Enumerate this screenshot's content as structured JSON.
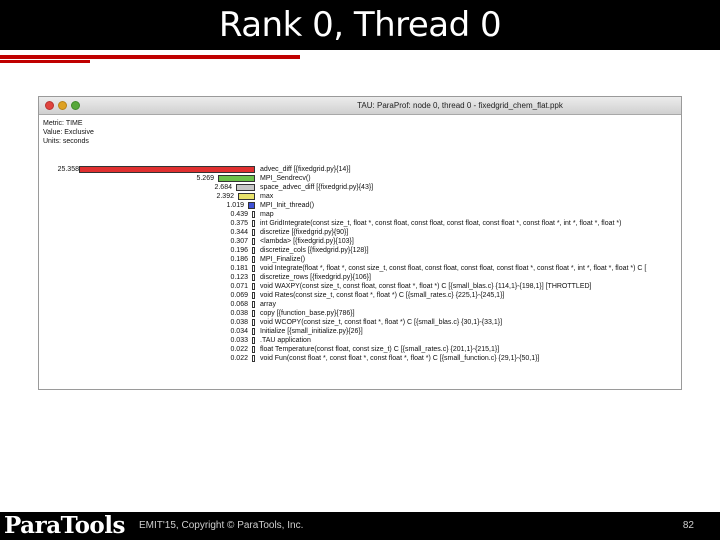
{
  "slide": {
    "title": "Rank 0, Thread 0",
    "footer": "EMIT'15, Copyright © ParaTools, Inc.",
    "page_number": "82",
    "logo_text": "ParaTools",
    "accent_color": "#c00000"
  },
  "window": {
    "title": "TAU: ParaProf: node 0, thread 0 - fixedgrid_chem_flat.ppk"
  },
  "metric": {
    "metric_line": "Metric: TIME",
    "value_line": "Value: Exclusive",
    "units_line": "Units: seconds"
  },
  "chart_data": {
    "type": "bar",
    "orientation": "horizontal",
    "metric": "TIME",
    "value": "Exclusive",
    "units": "seconds",
    "series": [
      {
        "value": "25.358",
        "v": 25.358,
        "label": "advec_diff [{fixedgrid.py}{14}]",
        "color": "#e03030"
      },
      {
        "value": "5.269",
        "v": 5.269,
        "label": "MPI_Sendrecv()",
        "color": "#6cc24a"
      },
      {
        "value": "2.684",
        "v": 2.684,
        "label": "space_advec_diff [{fixedgrid.py}{43}]",
        "color": "#c8c8c8"
      },
      {
        "value": "2.392",
        "v": 2.392,
        "label": "max",
        "color": "#e8e26a"
      },
      {
        "value": "1.019",
        "v": 1.019,
        "label": "MPI_Init_thread()",
        "color": "#3f52d6"
      },
      {
        "value": "0.439",
        "v": 0.439,
        "label": "map",
        "color": "#ffffff"
      },
      {
        "value": "0.375",
        "v": 0.375,
        "label": "int GridIntegrate(const size_t, float *, const float, const float, const float, const float *, const float *, int *, float *, float *)",
        "color": "#ffffff"
      },
      {
        "value": "0.344",
        "v": 0.344,
        "label": "discretize [{fixedgrid.py}{90}]",
        "color": "#ffffff"
      },
      {
        "value": "0.307",
        "v": 0.307,
        "label": "<lambda> [{fixedgrid.py}{103}]",
        "color": "#ffffff"
      },
      {
        "value": "0.196",
        "v": 0.196,
        "label": "discretize_cols [{fixedgrid.py}{128}]",
        "color": "#ffffff"
      },
      {
        "value": "0.186",
        "v": 0.186,
        "label": "MPI_Finalize()",
        "color": "#ffffff"
      },
      {
        "value": "0.181",
        "v": 0.181,
        "label": "void Integrate(float *, float *, const size_t, const float, const float, const float, const float *, const float *, int *, float *, float *) C [",
        "color": "#ffffff"
      },
      {
        "value": "0.123",
        "v": 0.123,
        "label": "discretize_rows [{fixedgrid.py}{106}]",
        "color": "#ffffff"
      },
      {
        "value": "0.071",
        "v": 0.071,
        "label": "void WAXPY(const size_t, const float, const float *, float *) C [{small_blas.c} {114,1}-{198,1}] [THROTTLED]",
        "color": "#ffffff"
      },
      {
        "value": "0.069",
        "v": 0.069,
        "label": "void Rates(const size_t, const float *, float *) C [{small_rates.c} {225,1}-{245,1}]",
        "color": "#ffffff"
      },
      {
        "value": "0.068",
        "v": 0.068,
        "label": "array",
        "color": "#ffffff"
      },
      {
        "value": "0.038",
        "v": 0.038,
        "label": "copy [{function_base.py}{786}]",
        "color": "#ffffff"
      },
      {
        "value": "0.038",
        "v": 0.038,
        "label": "void WCOPY(const size_t, const float *, float *) C [{small_blas.c} {30,1}-{33,1}]",
        "color": "#ffffff"
      },
      {
        "value": "0.034",
        "v": 0.034,
        "label": "Initialize [{small_initialize.py}{26}]",
        "color": "#ffffff"
      },
      {
        "value": "0.033",
        "v": 0.033,
        "label": ".TAU application",
        "color": "#ffffff"
      },
      {
        "value": "0.022",
        "v": 0.022,
        "label": "float Temperature(const float, const size_t) C [{small_rates.c} {201,1}-{215,1}]",
        "color": "#ffffff"
      },
      {
        "value": "0.022",
        "v": 0.022,
        "label": "void Fun(const float *, const float *, const float *, float *) C [{small_function.c} {29,1}-{50,1}]",
        "color": "#ffffff"
      }
    ]
  }
}
